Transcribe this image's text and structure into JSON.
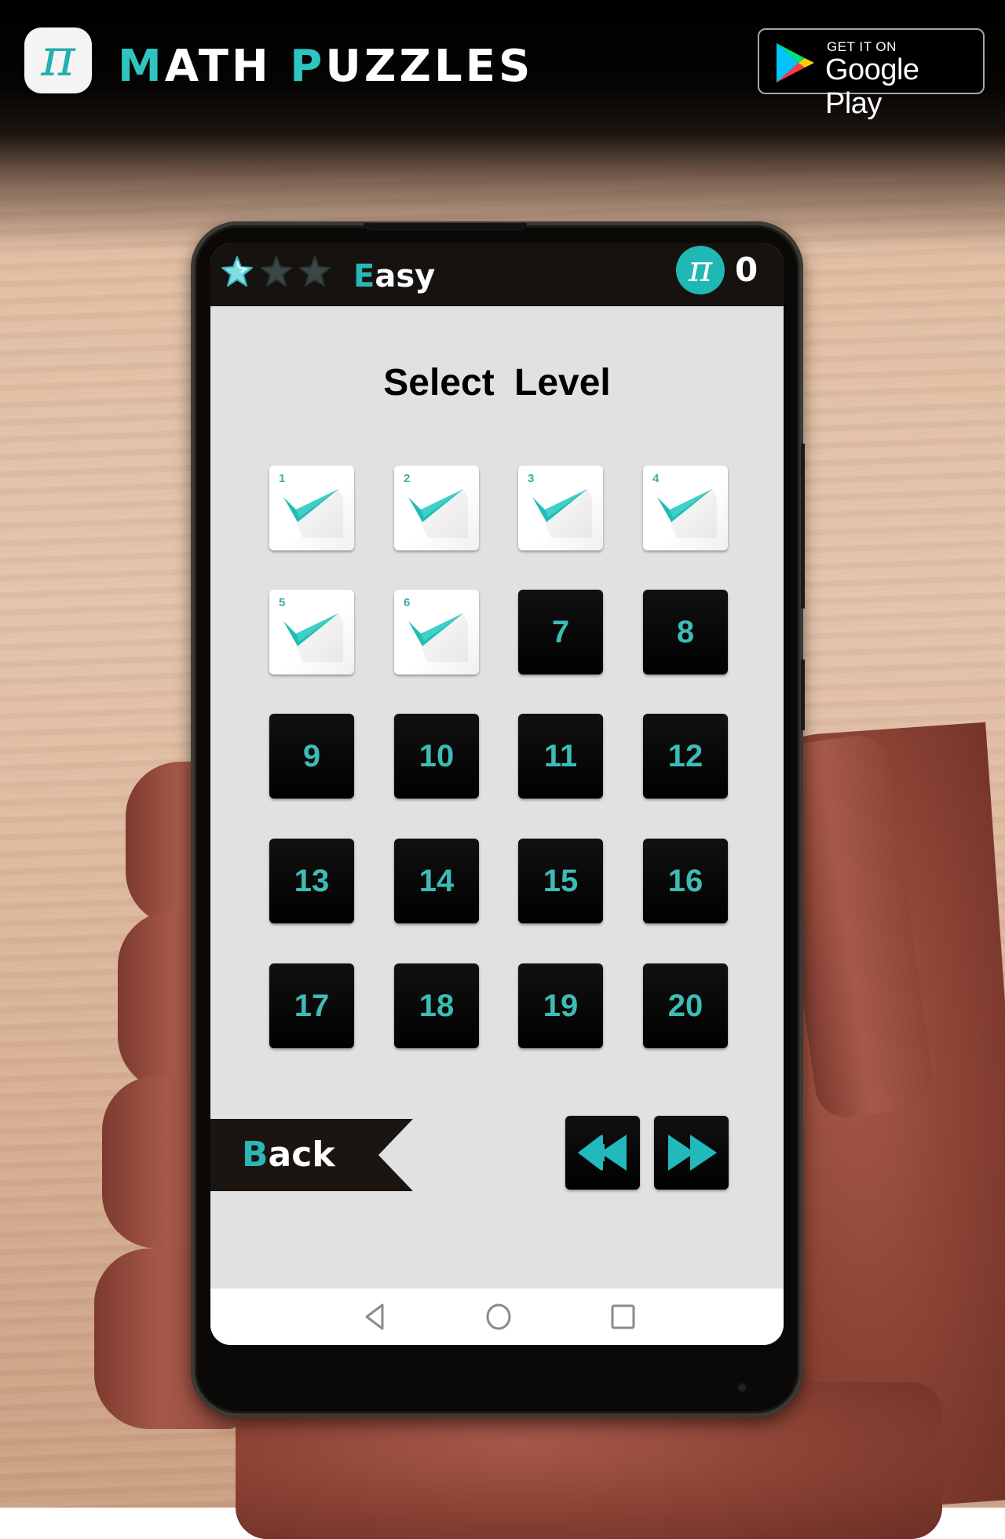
{
  "header": {
    "app_icon": "pi-symbol-icon",
    "app_icon_glyph": "π",
    "brand_title_part1_accent": "M",
    "brand_title_part1_rest": "ATH ",
    "brand_title_part2_accent": "P",
    "brand_title_part2_rest": "UZZLES",
    "store_badge": {
      "icon": "google-play-icon",
      "small_text": "GET IT ON",
      "large_text": "Google Play"
    }
  },
  "game": {
    "stars": {
      "earned": 1,
      "total": 3,
      "icon": "star-icon"
    },
    "difficulty_first": "E",
    "difficulty_rest": "asy",
    "coin_icon_glyph": "π",
    "coins": "0",
    "title": "Select Level",
    "levels": [
      {
        "number": "1",
        "completed": true
      },
      {
        "number": "2",
        "completed": true
      },
      {
        "number": "3",
        "completed": true
      },
      {
        "number": "4",
        "completed": true
      },
      {
        "number": "5",
        "completed": true
      },
      {
        "number": "6",
        "completed": true
      },
      {
        "number": "7",
        "completed": false
      },
      {
        "number": "8",
        "completed": false
      },
      {
        "number": "9",
        "completed": false
      },
      {
        "number": "10",
        "completed": false
      },
      {
        "number": "11",
        "completed": false
      },
      {
        "number": "12",
        "completed": false
      },
      {
        "number": "13",
        "completed": false
      },
      {
        "number": "14",
        "completed": false
      },
      {
        "number": "15",
        "completed": false
      },
      {
        "number": "16",
        "completed": false
      },
      {
        "number": "17",
        "completed": false
      },
      {
        "number": "18",
        "completed": false
      },
      {
        "number": "19",
        "completed": false
      },
      {
        "number": "20",
        "completed": false
      }
    ],
    "back_first": "B",
    "back_rest": "ack",
    "prev_page_icon": "rewind-icon",
    "next_page_icon": "fast-forward-icon"
  },
  "system_nav": {
    "back_icon": "nav-back-icon",
    "home_icon": "nav-home-icon",
    "recents_icon": "nav-recents-icon"
  },
  "colors": {
    "accent": "#2ec4c0",
    "tile_number": "#3dbcb6",
    "topbar": "#16120f",
    "screen_bg": "#e1e1e1"
  }
}
